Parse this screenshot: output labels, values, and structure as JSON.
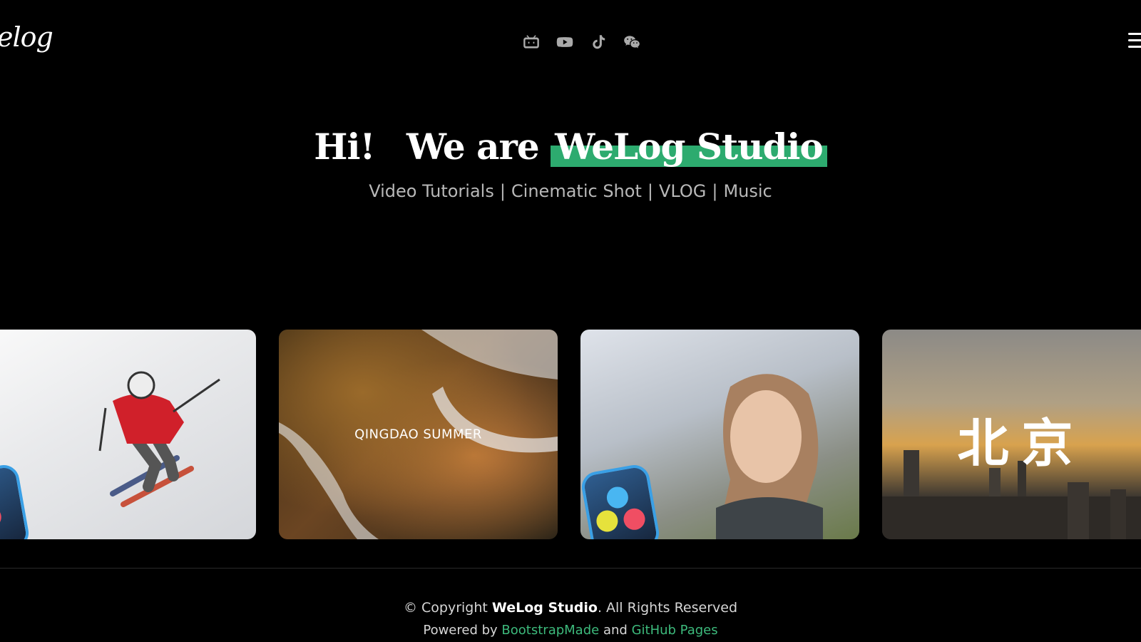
{
  "header": {
    "logo": "elog",
    "socials": [
      {
        "icon": "bilibili-icon"
      },
      {
        "icon": "youtube-icon"
      },
      {
        "icon": "tiktok-icon"
      },
      {
        "icon": "wechat-icon"
      }
    ]
  },
  "hero": {
    "greeting": "Hi!",
    "lead": "We are",
    "brand": "WeLog Studio",
    "tags": [
      "Video Tutorials",
      "Cinematic Shot",
      "VLOG",
      "Music"
    ],
    "separator": "|"
  },
  "gallery": {
    "cards": [
      {
        "caption": "",
        "icon": "skier-image"
      },
      {
        "caption": "QINGDAO SUMMER",
        "icon": "sea-waves-image"
      },
      {
        "caption": "",
        "icon": "woman-portrait-image"
      },
      {
        "caption": "北京",
        "icon": "beijing-skyline-image"
      }
    ]
  },
  "footer": {
    "copy_prefix": "© Copyright",
    "brand": "WeLog Studio",
    "copy_suffix": ". All Rights Reserved",
    "powered_by": "Powered by",
    "link1": "BootstrapMade",
    "and": "and",
    "link2": "GitHub Pages"
  },
  "colors": {
    "accent": "#2dab6f",
    "link": "#3dba7c",
    "background": "#000000"
  }
}
